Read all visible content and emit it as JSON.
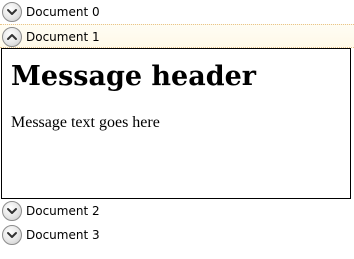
{
  "accordion": {
    "items": [
      {
        "label": "Document 0",
        "expanded": false,
        "icon": "chevron-down-icon"
      },
      {
        "label": "Document 1",
        "expanded": true,
        "icon": "chevron-up-icon"
      },
      {
        "label": "Document 2",
        "expanded": false,
        "icon": "chevron-down-icon"
      },
      {
        "label": "Document 3",
        "expanded": false,
        "icon": "chevron-down-icon"
      }
    ],
    "content": {
      "header": "Message header",
      "text": "Message text goes here"
    }
  },
  "colors": {
    "border": "#000000",
    "active_header_dotted_border": "#e8c58a",
    "button_border": "#8d8d8d"
  }
}
